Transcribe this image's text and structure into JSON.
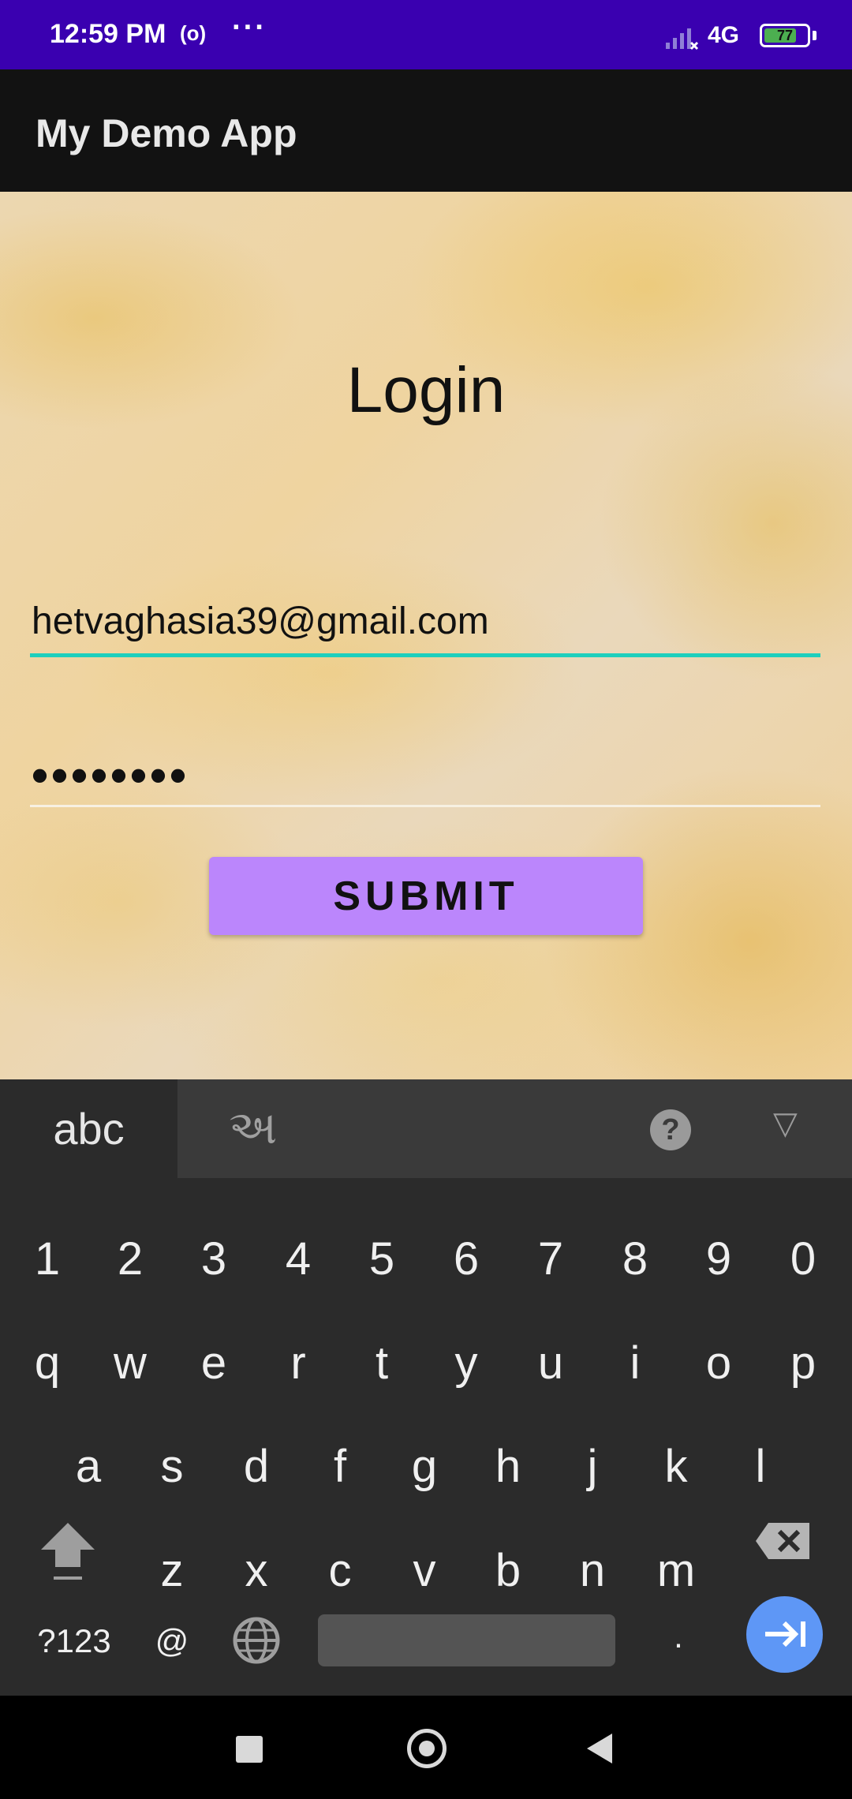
{
  "status_bar": {
    "time": "12:59 PM",
    "radio_icon_text": "(o)",
    "more_dots": "···",
    "network": "4G",
    "battery": "77",
    "battery_level": 0.77,
    "bg_color": "#3a00b0"
  },
  "app_bar": {
    "title": "My Demo App"
  },
  "login": {
    "title": "Login",
    "email_value": "hetvaghasia39@gmail.com",
    "password_value": "••••••••",
    "submit_label": "SUBMIT",
    "accent_color": "#1ecfbd",
    "button_color": "#bb86fc"
  },
  "keyboard": {
    "tab_abc": "abc",
    "tab_gujarati": "અ",
    "help_label": "?",
    "collapse_label": "▽",
    "number_row": [
      "1",
      "2",
      "3",
      "4",
      "5",
      "6",
      "7",
      "8",
      "9",
      "0"
    ],
    "row1": [
      "q",
      "w",
      "e",
      "r",
      "t",
      "y",
      "u",
      "i",
      "o",
      "p"
    ],
    "row2": [
      "a",
      "s",
      "d",
      "f",
      "g",
      "h",
      "j",
      "k",
      "l"
    ],
    "row3": [
      "z",
      "x",
      "c",
      "v",
      "b",
      "n",
      "m"
    ],
    "symbols_label": "?123",
    "at_label": "@",
    "period_label": ".",
    "enter_color": "#5e97f6"
  },
  "icons": {
    "signal": "signal-icon",
    "battery": "battery-icon",
    "shift": "shift-icon",
    "backspace": "backspace-icon",
    "globe": "globe-icon",
    "enter": "enter-arrow-icon",
    "nav_recent": "recent-apps-icon",
    "nav_home": "home-icon",
    "nav_back": "back-icon"
  }
}
